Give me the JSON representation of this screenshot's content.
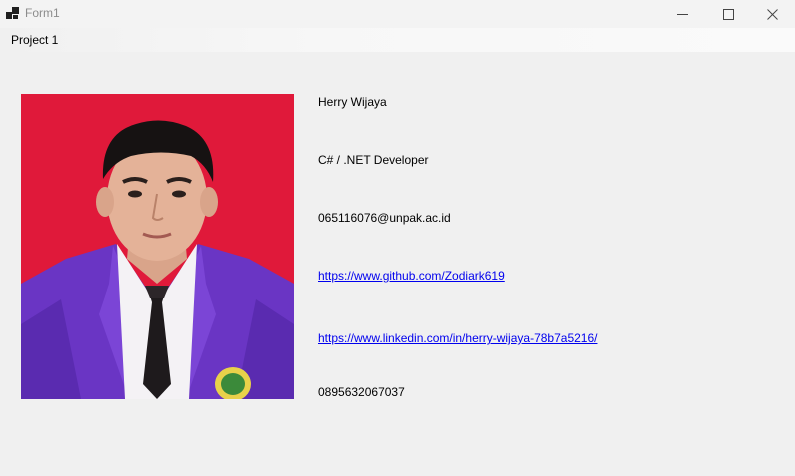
{
  "window": {
    "title": "Form1"
  },
  "menu": {
    "items": [
      {
        "label": "Project 1"
      }
    ]
  },
  "profile": {
    "photo_alt": "profile-photo",
    "name": "Herry Wijaya",
    "role": "C# / .NET Developer",
    "email": "065116076@unpak.ac.id",
    "github": "https://www.github.com/Zodiark619",
    "linkedin": "https://www.linkedin.com/in/herry-wijaya-78b7a5216/",
    "phone": "0895632067037"
  },
  "colors": {
    "link": "#0000ee",
    "photo_background": "#e0193a",
    "jacket": "#6a35c4"
  }
}
